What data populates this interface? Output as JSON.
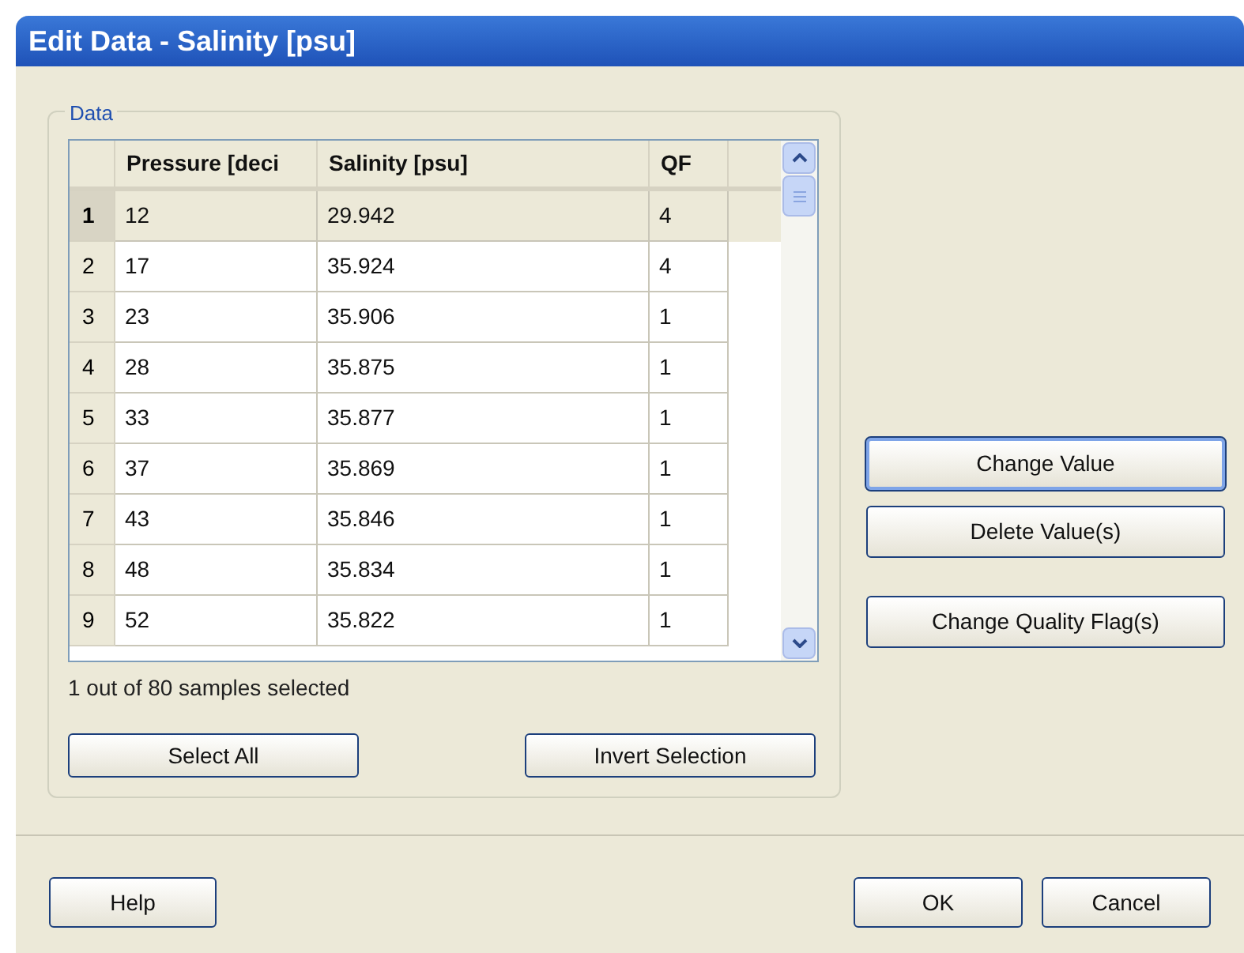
{
  "window": {
    "title": "Edit Data - Salinity [psu]"
  },
  "group": {
    "label": "Data"
  },
  "table": {
    "columns": [
      "Pressure [deci",
      "Salinity [psu]",
      "QF"
    ],
    "rows": [
      {
        "index": "1",
        "cells": [
          "12",
          "29.942",
          "4"
        ],
        "selected": true
      },
      {
        "index": "2",
        "cells": [
          "17",
          "35.924",
          "4"
        ],
        "selected": false
      },
      {
        "index": "3",
        "cells": [
          "23",
          "35.906",
          "1"
        ],
        "selected": false
      },
      {
        "index": "4",
        "cells": [
          "28",
          "35.875",
          "1"
        ],
        "selected": false
      },
      {
        "index": "5",
        "cells": [
          "33",
          "35.877",
          "1"
        ],
        "selected": false
      },
      {
        "index": "6",
        "cells": [
          "37",
          "35.869",
          "1"
        ],
        "selected": false
      },
      {
        "index": "7",
        "cells": [
          "43",
          "35.846",
          "1"
        ],
        "selected": false
      },
      {
        "index": "8",
        "cells": [
          "48",
          "35.834",
          "1"
        ],
        "selected": false
      },
      {
        "index": "9",
        "cells": [
          "52",
          "35.822",
          "1"
        ],
        "selected": false
      }
    ]
  },
  "status": "1 out of 80 samples selected",
  "group_buttons": [
    "Select All",
    "Invert Selection"
  ],
  "side_buttons": [
    {
      "label": "Change Value",
      "focused": true
    },
    {
      "label": "Delete Value(s)",
      "focused": false
    },
    {
      "label": "Change Quality Flag(s)",
      "focused": false
    }
  ],
  "footer_left": [
    "Help"
  ],
  "footer_right": [
    "OK",
    "Cancel"
  ]
}
